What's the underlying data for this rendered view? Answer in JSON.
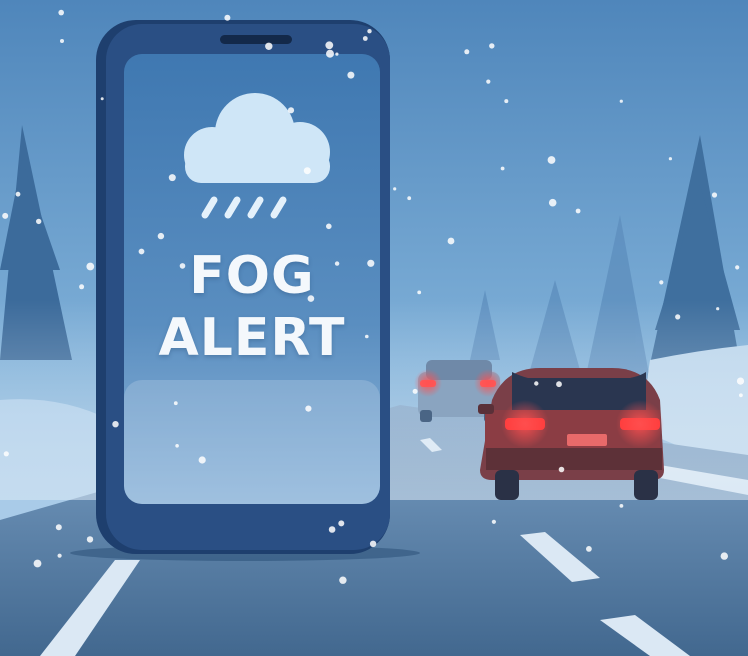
{
  "alert": {
    "line1": "FOG",
    "line2": "ALERT"
  },
  "icons": {
    "weather": "cloud-rain-icon"
  },
  "colors": {
    "sky": "#5a8ec0",
    "phone_body": "#264a7c",
    "screen": "#4f86bd",
    "tail_light": "#ff3b3b",
    "car_red": "#8a3a3e"
  }
}
